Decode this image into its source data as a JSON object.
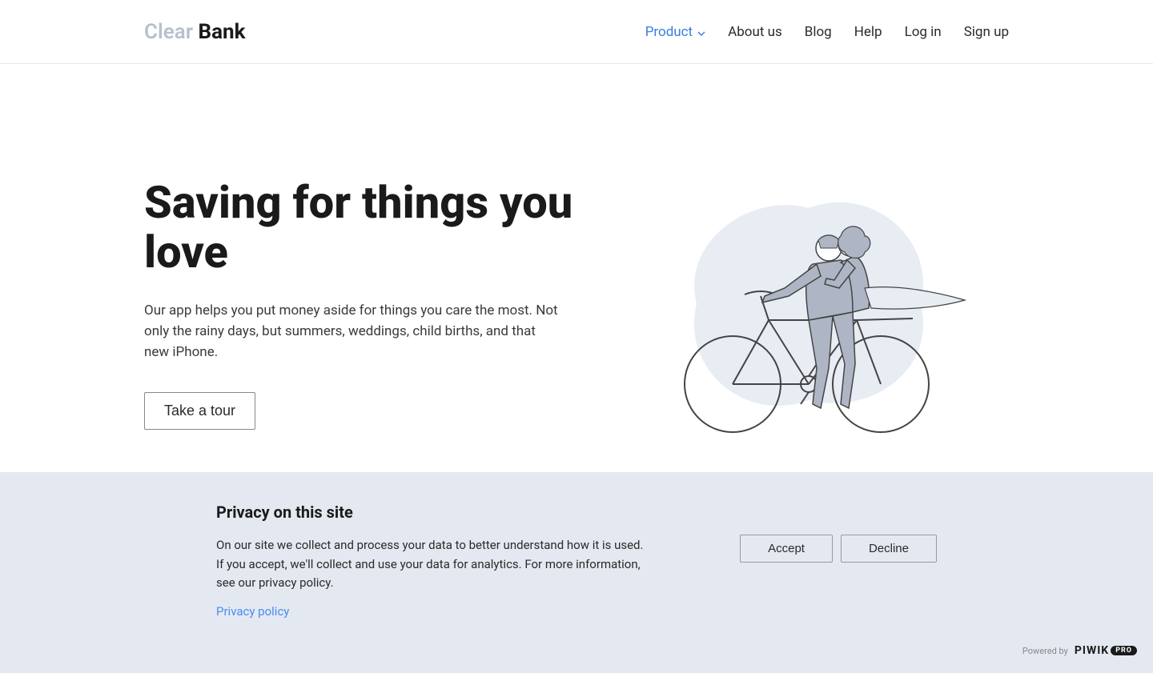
{
  "logo": {
    "clear": "Clear",
    "bank": " Bank"
  },
  "nav": {
    "product": "Product",
    "about": "About us",
    "blog": "Blog",
    "help": "Help",
    "login": "Log in",
    "signup": "Sign up"
  },
  "hero": {
    "title": "Saving for things you love",
    "body": "Our app helps you put money aside for things you care the most. Not only the rainy days, but summers, weddings, child births, and that new iPhone.",
    "cta": "Take a tour"
  },
  "cookie": {
    "title": "Privacy on this site",
    "body": "On our site we collect and process your data to better understand how it is used. If you accept, we'll collect and use your data for analytics. For more information, see our privacy policy.",
    "link": "Privacy policy",
    "accept": "Accept",
    "decline": "Decline",
    "powered": "Powered by",
    "piwik": "PIWIK",
    "pro": "PRO"
  }
}
